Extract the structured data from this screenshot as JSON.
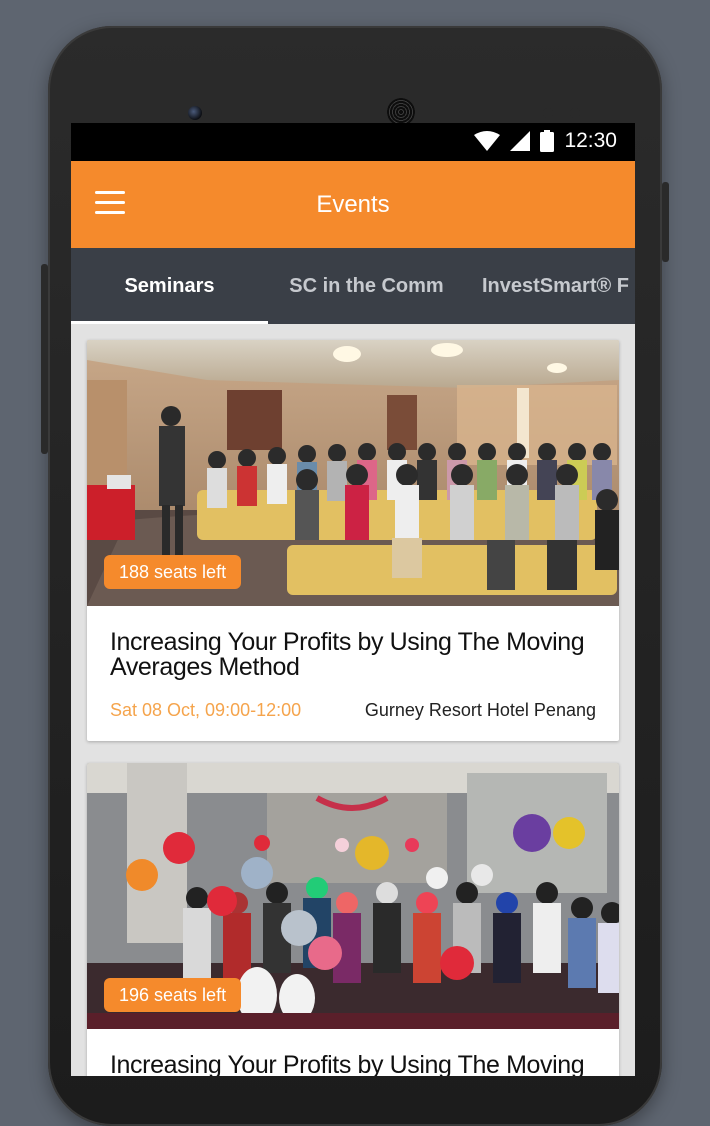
{
  "status_bar": {
    "time": "12:30",
    "icons": [
      "wifi-icon",
      "cell-signal-icon",
      "battery-icon"
    ]
  },
  "app_bar": {
    "title": "Events",
    "menu_icon": "hamburger-menu-icon"
  },
  "tabs": [
    {
      "label": "Seminars",
      "active": true
    },
    {
      "label": "SC in the Comm",
      "active": false
    },
    {
      "label": "InvestSmart® F",
      "active": false
    }
  ],
  "events": [
    {
      "seats_badge": "188 seats left",
      "title": "Increasing Your Profits by Using The Moving Averages Method",
      "date": "Sat 08 Oct, 09:00-12:00",
      "venue": "Gurney Resort Hotel Penang"
    },
    {
      "seats_badge": "196 seats left",
      "title": "Increasing Your Profits by Using The Moving",
      "date": "",
      "venue": ""
    }
  ],
  "colors": {
    "accent": "#f58a2c",
    "tab_bar": "#3a3f47",
    "date_text": "#f5a44c",
    "background": "#5e6570"
  }
}
